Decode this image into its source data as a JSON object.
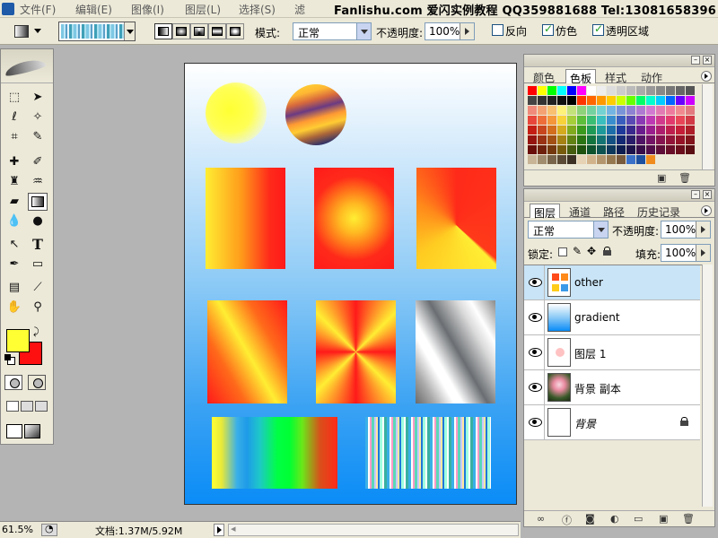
{
  "menubar": {
    "items": [
      "文件(F)",
      "编辑(E)",
      "图像(I)",
      "图层(L)",
      "选择(S)",
      "滤"
    ],
    "watermark": "Fanlishu.com 爱闪实例教程 QQ359881688 Tel:13081658396"
  },
  "options": {
    "mode_label": "模式:",
    "mode_value": "正常",
    "opacity_label": "不透明度:",
    "opacity_value": "100%",
    "reverse_label": "反向",
    "dither_label": "仿色",
    "transparency_label": "透明区域",
    "reverse_checked": false,
    "dither_checked": true,
    "transparency_checked": true
  },
  "toolbox": {
    "tools": [
      "marquee-icon",
      "move-icon",
      "lasso-icon",
      "magic-wand-icon",
      "crop-icon",
      "slice-icon",
      "healing-brush-icon",
      "brush-icon",
      "clone-stamp-icon",
      "history-brush-icon",
      "eraser-icon",
      "gradient-icon",
      "blur-icon",
      "dodge-icon",
      "path-select-icon",
      "type-icon",
      "pen-icon",
      "shape-icon",
      "notes-icon",
      "eyedropper-icon",
      "hand-icon",
      "zoom-icon"
    ],
    "type_glyph": "T",
    "foreground_color": "#ffff33",
    "background_color": "#ff1010"
  },
  "status": {
    "zoom": "61.5%",
    "doc_info": "文档:1.37M/5.92M"
  },
  "swatches_panel": {
    "tabs": [
      "颜色",
      "色板",
      "样式",
      "动作"
    ],
    "active_tab": "色板",
    "rows": [
      [
        "#ff0000",
        "#ffff00",
        "#00ff00",
        "#00ffff",
        "#0000ff",
        "#ff00ff",
        "#ffffff",
        "#eeeeee",
        "#dddddd",
        "#cccccc",
        "#bbbbbb",
        "#aaaaaa",
        "#999999",
        "#888888",
        "#777777",
        "#666666",
        "#555555"
      ],
      [
        "#444444",
        "#333333",
        "#222222",
        "#111111",
        "#000000",
        "#ff3300",
        "#ff6600",
        "#ff9900",
        "#ffcc00",
        "#ccff00",
        "#66ff00",
        "#00ff66",
        "#00ffcc",
        "#00ccff",
        "#0066ff",
        "#6600ff",
        "#cc00ff"
      ],
      [
        "#f08a7a",
        "#f4a274",
        "#f8c070",
        "#fff27a",
        "#c4e27a",
        "#8ed27a",
        "#74d2a0",
        "#74d2d2",
        "#74b4e2",
        "#7a94d8",
        "#8e82d2",
        "#ae7ad2",
        "#d27ad2",
        "#e27ab4",
        "#ee7a9e",
        "#f08a90",
        "#e27a80"
      ],
      [
        "#e8463a",
        "#ee6e3a",
        "#f4963a",
        "#f8d23a",
        "#a6ce3a",
        "#5cbe3a",
        "#3abe74",
        "#3abebe",
        "#3a8ece",
        "#3a5ebe",
        "#5a4ab4",
        "#8a3ab4",
        "#be3ab4",
        "#d23a8e",
        "#e23a6e",
        "#e84658",
        "#d23a46"
      ],
      [
        "#c41e14",
        "#c8461e",
        "#d26e1e",
        "#d6aa1e",
        "#82aa1e",
        "#3a9a1e",
        "#1e9a56",
        "#1e9a9a",
        "#1e6eaa",
        "#1e3a9a",
        "#3a2a8e",
        "#6a1e8e",
        "#9a1e8e",
        "#ae1e6e",
        "#be1e4e",
        "#c41e38",
        "#ae1e28"
      ],
      [
        "#961410",
        "#9a3214",
        "#a25014",
        "#a68214",
        "#628214",
        "#2a7414",
        "#147440",
        "#147474",
        "#145082",
        "#142a74",
        "#2a1e6a",
        "#501466",
        "#741466",
        "#861450",
        "#921438",
        "#961428",
        "#82141c"
      ],
      [
        "#6a0e0a",
        "#6e220e",
        "#74380e",
        "#785c0e",
        "#465c0e",
        "#1e520e",
        "#0e522e",
        "#0e5252",
        "#0e385c",
        "#0e1e52",
        "#1e144c",
        "#380e4a",
        "#520e4a",
        "#5e0e38",
        "#680e28",
        "#6a0e1c",
        "#5a0e12"
      ],
      [
        "#c8b496",
        "#a08c6e",
        "#78644a",
        "#5a4a36",
        "#3c3024",
        "#e6d2b4",
        "#d2b48c",
        "#b4966e",
        "#967850",
        "#785a3c",
        "#3a70c8",
        "#1e50a0",
        "#f08c1e"
      ]
    ]
  },
  "layers_panel": {
    "tabs": [
      "图层",
      "通道",
      "路径",
      "历史记录"
    ],
    "active_tab": "图层",
    "blend_mode": "正常",
    "opacity_label": "不透明度:",
    "opacity_value": "100%",
    "lock_label": "锁定:",
    "fill_label": "填充:",
    "fill_value": "100%",
    "layers": [
      {
        "name": "other",
        "selected": true
      },
      {
        "name": "gradient",
        "selected": false
      },
      {
        "name": "图层 1",
        "selected": false
      },
      {
        "name": "背景 副本",
        "selected": false
      },
      {
        "name": "背景",
        "selected": false,
        "locked": true
      }
    ]
  },
  "canvas": {
    "colors": {
      "yellow": "#ffff33",
      "orange": "#ff8c00",
      "red": "#ff1a1a",
      "blue_bottom": "#0a8cf7"
    }
  }
}
